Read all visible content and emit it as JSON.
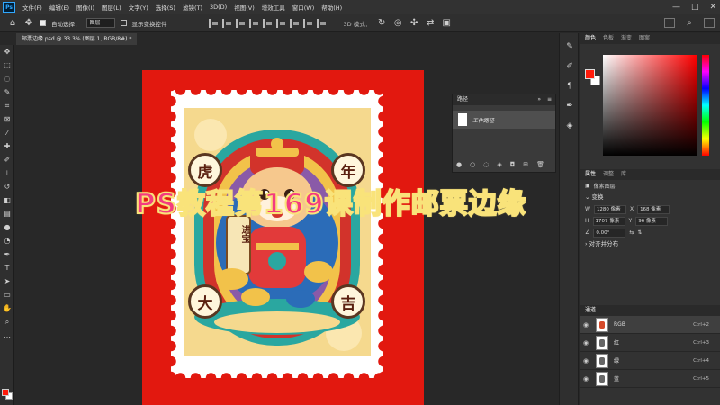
{
  "menubar": {
    "logo": "Ps",
    "items": [
      "文件(F)",
      "编辑(E)",
      "图像(I)",
      "图层(L)",
      "文字(Y)",
      "选择(S)",
      "滤镜(T)",
      "3D(D)",
      "视图(V)",
      "增效工具",
      "窗口(W)",
      "帮助(H)"
    ],
    "window_controls": [
      "—",
      "□",
      "✕"
    ]
  },
  "options": {
    "auto_select_label": "自动选择：",
    "auto_select_value": "图层",
    "show_transform_label": "显示变换控件",
    "mode_3d_label": "3D 模式："
  },
  "document": {
    "tab_title": "邮票边缘.psd @ 33.3% (图层 1, RGB/8#) *"
  },
  "artwork": {
    "badge_tl": "虎",
    "badge_tr": "年",
    "badge_bl": "大",
    "badge_br": "吉",
    "scroll_text": "进宝"
  },
  "overlay_title": "PS教程第169课制作邮票边缘",
  "paths_panel": {
    "title": "路径",
    "path_name": "工作路径"
  },
  "color_panel": {
    "tabs": [
      "颜色",
      "色板",
      "渐变",
      "图案"
    ],
    "foreground": "#ff1a0a",
    "background": "#ffffff"
  },
  "properties": {
    "tabs": [
      "属性",
      "调整",
      "库"
    ],
    "layer_type": "像素图层",
    "transform_label": "变换",
    "w_label": "W",
    "w_value": "1280 像素",
    "x_label": "X",
    "x_value": "168 像素",
    "h_label": "H",
    "h_value": "1707 像素",
    "y_label": "Y",
    "y_value": "96 像素",
    "angle_value": "0.00°",
    "align_label": "对齐并分布"
  },
  "channels": {
    "title": "通道",
    "rows": [
      {
        "name": "RGB",
        "shortcut": "Ctrl+2"
      },
      {
        "name": "红",
        "shortcut": "Ctrl+3"
      },
      {
        "name": "绿",
        "shortcut": "Ctrl+4"
      },
      {
        "name": "蓝",
        "shortcut": "Ctrl+5"
      }
    ]
  },
  "colors": {
    "canvas_red": "#e2180f",
    "title_pink": "#f43b80",
    "title_outline": "#f9e37a"
  }
}
